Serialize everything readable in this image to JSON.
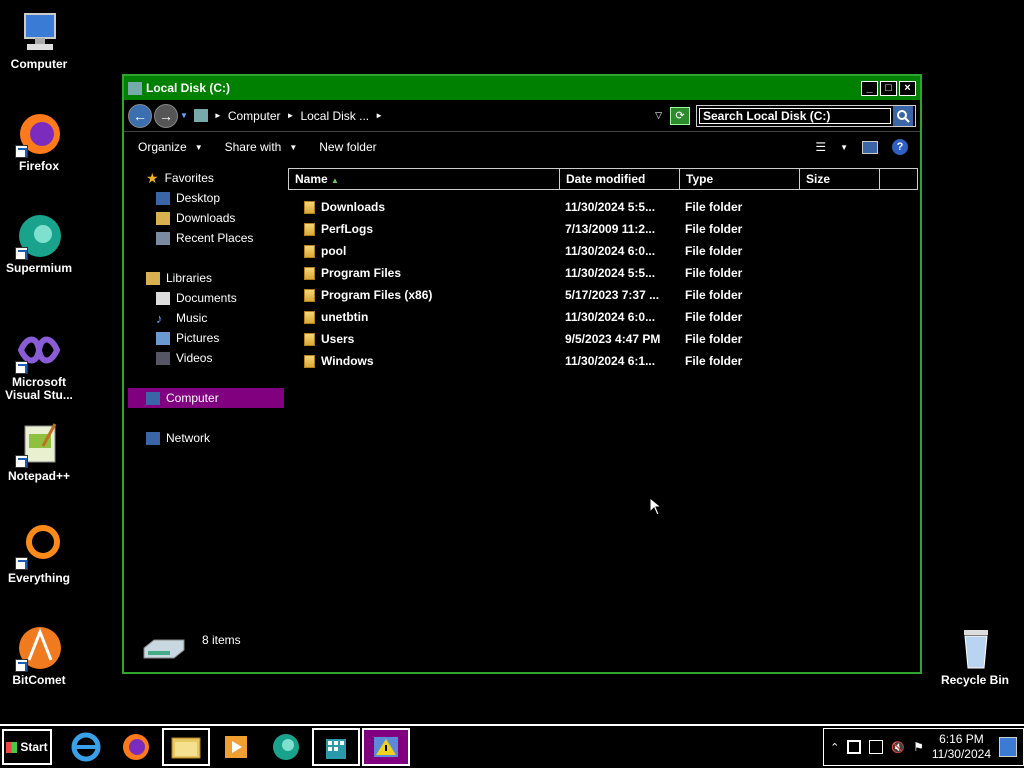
{
  "desktop": {
    "icons": [
      {
        "label": "Computer"
      },
      {
        "label": "Firefox"
      },
      {
        "label": "Supermium"
      },
      {
        "label": "Microsoft Visual Stu..."
      },
      {
        "label": "Notepad++"
      },
      {
        "label": "Everything"
      },
      {
        "label": "BitComet"
      }
    ],
    "recycle_bin": "Recycle Bin"
  },
  "window": {
    "title": "Local Disk (C:)",
    "breadcrumb": [
      "Computer",
      "Local Disk ..."
    ],
    "search_placeholder": "Search Local Disk (C:)",
    "toolbar": {
      "organize": "Organize",
      "share_with": "Share with",
      "new_folder": "New folder"
    },
    "nav": {
      "favorites": "Favorites",
      "desktop": "Desktop",
      "downloads": "Downloads",
      "recent_places": "Recent Places",
      "libraries": "Libraries",
      "documents": "Documents",
      "music": "Music",
      "pictures": "Pictures",
      "videos": "Videos",
      "computer": "Computer",
      "network": "Network"
    },
    "columns": {
      "name": "Name",
      "date": "Date modified",
      "type": "Type",
      "size": "Size"
    },
    "files": [
      {
        "name": "Downloads",
        "date": "11/30/2024 5:5...",
        "type": "File folder"
      },
      {
        "name": "PerfLogs",
        "date": "7/13/2009 11:2...",
        "type": "File folder"
      },
      {
        "name": "pool",
        "date": "11/30/2024 6:0...",
        "type": "File folder"
      },
      {
        "name": "Program Files",
        "date": "11/30/2024 5:5...",
        "type": "File folder"
      },
      {
        "name": "Program Files (x86)",
        "date": "5/17/2023 7:37 ...",
        "type": "File folder"
      },
      {
        "name": "unetbtin",
        "date": "11/30/2024 6:0...",
        "type": "File folder"
      },
      {
        "name": "Users",
        "date": "9/5/2023 4:47 PM",
        "type": "File folder"
      },
      {
        "name": "Windows",
        "date": "11/30/2024 6:1...",
        "type": "File folder"
      }
    ],
    "status": "8 items"
  },
  "taskbar": {
    "start": "Start",
    "time": "6:16 PM",
    "date": "11/30/2024"
  }
}
